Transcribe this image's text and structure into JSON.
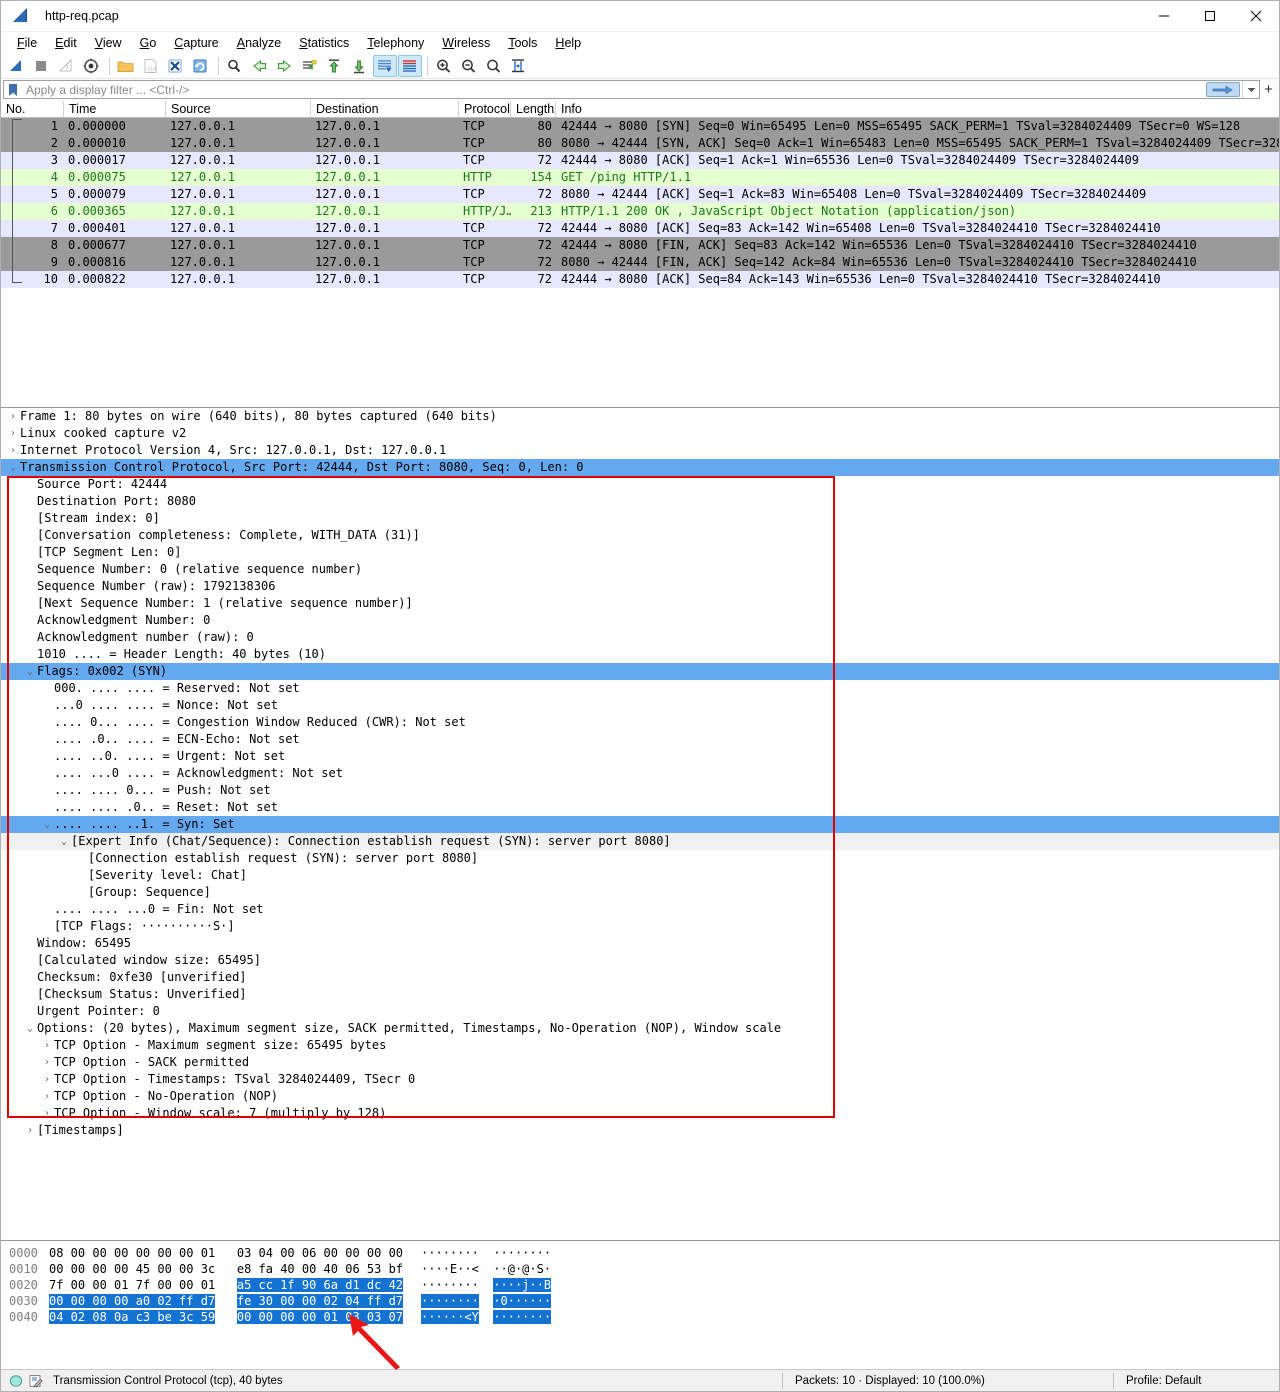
{
  "window": {
    "title": "http-req.pcap",
    "icon": "wireshark-fin-icon",
    "minimize": "–",
    "maximize": "□",
    "close": "×"
  },
  "menubar": {
    "items": [
      {
        "label": "File",
        "accel": "F"
      },
      {
        "label": "Edit",
        "accel": "E"
      },
      {
        "label": "View",
        "accel": "V"
      },
      {
        "label": "Go",
        "accel": "G"
      },
      {
        "label": "Capture",
        "accel": "C"
      },
      {
        "label": "Analyze",
        "accel": "A"
      },
      {
        "label": "Statistics",
        "accel": "S"
      },
      {
        "label": "Telephony",
        "accel": "T"
      },
      {
        "label": "Wireless",
        "accel": "W"
      },
      {
        "label": "Tools",
        "accel": "T"
      },
      {
        "label": "Help",
        "accel": "H"
      }
    ]
  },
  "toolbar": {
    "buttons": [
      {
        "name": "start-capture-icon",
        "enabled": true
      },
      {
        "name": "stop-capture-icon",
        "enabled": true
      },
      {
        "name": "restart-capture-icon",
        "enabled": false
      },
      {
        "name": "capture-options-icon",
        "enabled": true
      },
      {
        "name": "open-file-icon",
        "enabled": true
      },
      {
        "name": "save-file-icon",
        "enabled": false
      },
      {
        "name": "close-file-icon",
        "enabled": true
      },
      {
        "name": "reload-file-icon",
        "enabled": true
      },
      {
        "name": "find-packet-icon",
        "enabled": true
      },
      {
        "name": "go-back-icon",
        "enabled": true
      },
      {
        "name": "go-forward-icon",
        "enabled": true
      },
      {
        "name": "go-to-packet-icon",
        "enabled": true
      },
      {
        "name": "go-to-first-icon",
        "enabled": true
      },
      {
        "name": "go-to-last-icon",
        "enabled": true
      },
      {
        "name": "auto-scroll-icon",
        "enabled": true
      },
      {
        "name": "colorize-icon",
        "enabled": true
      },
      {
        "name": "zoom-in-icon",
        "enabled": true
      },
      {
        "name": "zoom-out-icon",
        "enabled": true
      },
      {
        "name": "zoom-reset-icon",
        "enabled": true
      },
      {
        "name": "resize-columns-icon",
        "enabled": true
      }
    ]
  },
  "filter": {
    "placeholder": "Apply a display filter ... <Ctrl-/>",
    "value": "",
    "bookmark_icon": "bookmark-icon",
    "apply_icon": "apply-filter-arrow-icon",
    "dropdown_icon": "chevron-down-icon",
    "add_icon": "plus-icon"
  },
  "packet_list": {
    "columns": [
      "No.",
      "Time",
      "Source",
      "Destination",
      "Protocol",
      "Length",
      "Info"
    ],
    "rows": [
      {
        "no": "1",
        "time": "0.000000",
        "src": "127.0.0.1",
        "dst": "127.0.0.1",
        "proto": "TCP",
        "len": "80",
        "info": "42444 → 8080 [SYN] Seq=0 Win=65495 Len=0 MSS=65495 SACK_PERM=1 TSval=3284024409 TSecr=0 WS=128",
        "style": "rowgray"
      },
      {
        "no": "2",
        "time": "0.000010",
        "src": "127.0.0.1",
        "dst": "127.0.0.1",
        "proto": "TCP",
        "len": "80",
        "info": "8080 → 42444 [SYN, ACK] Seq=0 Ack=1 Win=65483 Len=0 MSS=65495 SACK_PERM=1 TSval=3284024409 TSecr=3284…",
        "style": "rowgray"
      },
      {
        "no": "3",
        "time": "0.000017",
        "src": "127.0.0.1",
        "dst": "127.0.0.1",
        "proto": "TCP",
        "len": "72",
        "info": "42444 → 8080 [ACK] Seq=1 Ack=1 Win=65536 Len=0 TSval=3284024409 TSecr=3284024409",
        "style": "rowlav"
      },
      {
        "no": "4",
        "time": "0.000075",
        "src": "127.0.0.1",
        "dst": "127.0.0.1",
        "proto": "HTTP",
        "len": "154",
        "info": "GET /ping HTTP/1.1",
        "style": "rowgreen"
      },
      {
        "no": "5",
        "time": "0.000079",
        "src": "127.0.0.1",
        "dst": "127.0.0.1",
        "proto": "TCP",
        "len": "72",
        "info": "8080 → 42444 [ACK] Seq=1 Ack=83 Win=65408 Len=0 TSval=3284024409 TSecr=3284024409",
        "style": "rowlav"
      },
      {
        "no": "6",
        "time": "0.000365",
        "src": "127.0.0.1",
        "dst": "127.0.0.1",
        "proto": "HTTP/J…",
        "len": "213",
        "info": "HTTP/1.1 200 OK , JavaScript Object Notation (application/json)",
        "style": "rowgreen"
      },
      {
        "no": "7",
        "time": "0.000401",
        "src": "127.0.0.1",
        "dst": "127.0.0.1",
        "proto": "TCP",
        "len": "72",
        "info": "42444 → 8080 [ACK] Seq=83 Ack=142 Win=65408 Len=0 TSval=3284024410 TSecr=3284024410",
        "style": "rowlav"
      },
      {
        "no": "8",
        "time": "0.000677",
        "src": "127.0.0.1",
        "dst": "127.0.0.1",
        "proto": "TCP",
        "len": "72",
        "info": "42444 → 8080 [FIN, ACK] Seq=83 Ack=142 Win=65536 Len=0 TSval=3284024410 TSecr=3284024410",
        "style": "rowgray"
      },
      {
        "no": "9",
        "time": "0.000816",
        "src": "127.0.0.1",
        "dst": "127.0.0.1",
        "proto": "TCP",
        "len": "72",
        "info": "8080 → 42444 [FIN, ACK] Seq=142 Ack=84 Win=65536 Len=0 TSval=3284024410 TSecr=3284024410",
        "style": "rowgray"
      },
      {
        "no": "10",
        "time": "0.000822",
        "src": "127.0.0.1",
        "dst": "127.0.0.1",
        "proto": "TCP",
        "len": "72",
        "info": "42444 → 8080 [ACK] Seq=84 Ack=143 Win=65536 Len=0 TSval=3284024410 TSecr=3284024410",
        "style": "rowlav"
      }
    ]
  },
  "packet_detail": {
    "lines": [
      {
        "text": "Frame 1: 80 bytes on wire (640 bits), 80 bytes captured (640 bits)",
        "indent": 0,
        "twisty": "collapsed",
        "style": ""
      },
      {
        "text": "Linux cooked capture v2",
        "indent": 0,
        "twisty": "collapsed",
        "style": ""
      },
      {
        "text": "Internet Protocol Version 4, Src: 127.0.0.1, Dst: 127.0.0.1",
        "indent": 0,
        "twisty": "collapsed",
        "style": ""
      },
      {
        "text": "Transmission Control Protocol, Src Port: 42444, Dst Port: 8080, Seq: 0, Len: 0",
        "indent": 0,
        "twisty": "expanded",
        "style": "sel"
      },
      {
        "text": "Source Port: 42444",
        "indent": 1,
        "twisty": "none",
        "style": ""
      },
      {
        "text": "Destination Port: 8080",
        "indent": 1,
        "twisty": "none",
        "style": ""
      },
      {
        "text": "[Stream index: 0]",
        "indent": 1,
        "twisty": "none",
        "style": ""
      },
      {
        "text": "[Conversation completeness: Complete, WITH_DATA (31)]",
        "indent": 1,
        "twisty": "none",
        "style": ""
      },
      {
        "text": "[TCP Segment Len: 0]",
        "indent": 1,
        "twisty": "none",
        "style": ""
      },
      {
        "text": "Sequence Number: 0    (relative sequence number)",
        "indent": 1,
        "twisty": "none",
        "style": ""
      },
      {
        "text": "Sequence Number (raw): 1792138306",
        "indent": 1,
        "twisty": "none",
        "style": ""
      },
      {
        "text": "[Next Sequence Number: 1    (relative sequence number)]",
        "indent": 1,
        "twisty": "none",
        "style": ""
      },
      {
        "text": "Acknowledgment Number: 0",
        "indent": 1,
        "twisty": "none",
        "style": ""
      },
      {
        "text": "Acknowledgment number (raw): 0",
        "indent": 1,
        "twisty": "none",
        "style": ""
      },
      {
        "text": "1010 .... = Header Length: 40 bytes (10)",
        "indent": 1,
        "twisty": "none",
        "style": ""
      },
      {
        "text": "Flags: 0x002 (SYN)",
        "indent": 1,
        "twisty": "expanded",
        "style": "sel"
      },
      {
        "text": "000. .... .... = Reserved: Not set",
        "indent": 2,
        "twisty": "none",
        "style": ""
      },
      {
        "text": "...0 .... .... = Nonce: Not set",
        "indent": 2,
        "twisty": "none",
        "style": ""
      },
      {
        "text": ".... 0... .... = Congestion Window Reduced (CWR): Not set",
        "indent": 2,
        "twisty": "none",
        "style": ""
      },
      {
        "text": ".... .0.. .... = ECN-Echo: Not set",
        "indent": 2,
        "twisty": "none",
        "style": ""
      },
      {
        "text": ".... ..0. .... = Urgent: Not set",
        "indent": 2,
        "twisty": "none",
        "style": ""
      },
      {
        "text": ".... ...0 .... = Acknowledgment: Not set",
        "indent": 2,
        "twisty": "none",
        "style": ""
      },
      {
        "text": ".... .... 0... = Push: Not set",
        "indent": 2,
        "twisty": "none",
        "style": ""
      },
      {
        "text": ".... .... .0.. = Reset: Not set",
        "indent": 2,
        "twisty": "none",
        "style": ""
      },
      {
        "text": ".... .... ..1. = Syn: Set",
        "indent": 2,
        "twisty": "expanded",
        "style": "sel"
      },
      {
        "text": "[Expert Info (Chat/Sequence): Connection establish request (SYN): server port 8080]",
        "indent": 3,
        "twisty": "expanded",
        "style": "expert"
      },
      {
        "text": "[Connection establish request (SYN): server port 8080]",
        "indent": 4,
        "twisty": "none",
        "style": ""
      },
      {
        "text": "[Severity level: Chat]",
        "indent": 4,
        "twisty": "none",
        "style": ""
      },
      {
        "text": "[Group: Sequence]",
        "indent": 4,
        "twisty": "none",
        "style": ""
      },
      {
        "text": ".... .... ...0 = Fin: Not set",
        "indent": 2,
        "twisty": "none",
        "style": ""
      },
      {
        "text": "[TCP Flags: ··········S·]",
        "indent": 2,
        "twisty": "none",
        "style": ""
      },
      {
        "text": "Window: 65495",
        "indent": 1,
        "twisty": "none",
        "style": ""
      },
      {
        "text": "[Calculated window size: 65495]",
        "indent": 1,
        "twisty": "none",
        "style": ""
      },
      {
        "text": "Checksum: 0xfe30 [unverified]",
        "indent": 1,
        "twisty": "none",
        "style": ""
      },
      {
        "text": "[Checksum Status: Unverified]",
        "indent": 1,
        "twisty": "none",
        "style": ""
      },
      {
        "text": "Urgent Pointer: 0",
        "indent": 1,
        "twisty": "none",
        "style": ""
      },
      {
        "text": "Options: (20 bytes), Maximum segment size, SACK permitted, Timestamps, No-Operation (NOP), Window scale",
        "indent": 1,
        "twisty": "expanded",
        "style": ""
      },
      {
        "text": "TCP Option - Maximum segment size: 65495 bytes",
        "indent": 2,
        "twisty": "collapsed",
        "style": ""
      },
      {
        "text": "TCP Option - SACK permitted",
        "indent": 2,
        "twisty": "collapsed",
        "style": ""
      },
      {
        "text": "TCP Option - Timestamps: TSval 3284024409, TSecr 0",
        "indent": 2,
        "twisty": "collapsed",
        "style": ""
      },
      {
        "text": "TCP Option - No-Operation (NOP)",
        "indent": 2,
        "twisty": "collapsed",
        "style": ""
      },
      {
        "text": "TCP Option - Window scale: 7 (multiply by 128)",
        "indent": 2,
        "twisty": "collapsed",
        "style": ""
      },
      {
        "text": "[Timestamps]",
        "indent": 1,
        "twisty": "collapsed",
        "style": ""
      }
    ]
  },
  "hex_dump": {
    "rows": [
      {
        "offset": "0000",
        "bytes_plain_left": "08 00 00 00 00 00 00 01",
        "bytes_plain_right": "03 04 00 06 00 00 00 00",
        "bytes_hl_left": "",
        "bytes_hl_right": "",
        "ascii_left": "········",
        "ascii_right": "········",
        "ascii_hl_left": "",
        "ascii_hl_right": ""
      },
      {
        "offset": "0010",
        "bytes_plain_left": "00 00 00 00 45 00 00 3c",
        "bytes_plain_right": "e8 fa 40 00 40 06 53 bf",
        "bytes_hl_left": "",
        "bytes_hl_right": "",
        "ascii_left": "····E··<",
        "ascii_right": "··@·@·S·",
        "ascii_hl_left": "",
        "ascii_hl_right": ""
      },
      {
        "offset": "0020",
        "bytes_plain_left": "7f 00 00 01 7f 00 00 01",
        "bytes_plain_right": "",
        "bytes_hl_left": "",
        "bytes_hl_right": "a5 cc 1f 90 6a d1 dc 42",
        "ascii_left": "········",
        "ascii_right": "",
        "ascii_hl_left": "",
        "ascii_hl_right": "····j··B"
      },
      {
        "offset": "0030",
        "bytes_plain_left": "",
        "bytes_plain_right": "",
        "bytes_hl_left": "00 00 00 00 a0 02 ff d7",
        "bytes_hl_right": "fe 30 00 00 02 04 ff d7",
        "ascii_left": "",
        "ascii_right": "",
        "ascii_hl_left": "········",
        "ascii_hl_right": "·0······"
      },
      {
        "offset": "0040",
        "bytes_plain_left": "",
        "bytes_plain_right": "",
        "bytes_hl_left": "04 02 08 0a c3 be 3c 59",
        "bytes_hl_right": "00 00 00 00 01 03 03 07",
        "ascii_left": "",
        "ascii_right": "",
        "ascii_hl_left": "······<Y",
        "ascii_hl_right": "········"
      }
    ]
  },
  "annotations": {
    "red_box_label": "tcp-detail-highlight-box",
    "red_arrow_label": "hex-bytes-pointer-arrow",
    "accent_red": "#e00000"
  },
  "statusbar": {
    "expert_icon": "expert-info-icon",
    "comment_icon": "capture-comment-icon",
    "left": "Transmission Control Protocol (tcp), 40 bytes",
    "middle": "Packets: 10 · Displayed: 10 (100.0%)",
    "right": "Profile: Default"
  },
  "colors": {
    "row_gray": "#9a9a9a",
    "row_lavender": "#e7e7ff",
    "row_green": "#e6ffd0",
    "selection_blue": "#64a8f0",
    "hex_highlight": "#1472d1"
  }
}
